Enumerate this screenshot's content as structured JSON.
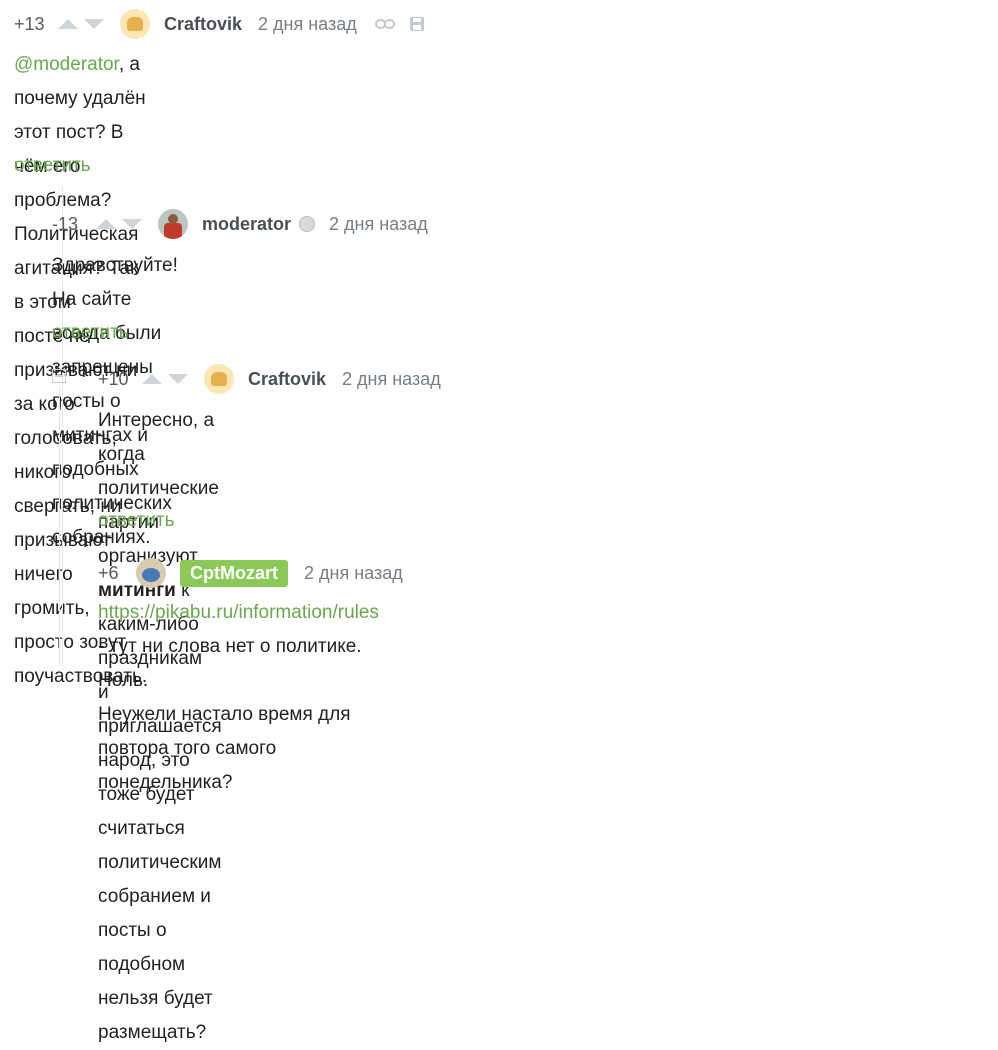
{
  "comments": [
    {
      "rating": "+13",
      "author": "Craftovik",
      "time": "2 дня назад",
      "mention": "@moderator",
      "text_line1": ", а почему удалён этот пост? В чём его проблема? Политическая агитация? Так в этом",
      "text_line2": "посте не призывают ни за кого голосовать, никого свергать, ни призывают ничего громить,",
      "text_line3": "просто зовут поучаствовать.",
      "reply": "ответить",
      "icons": [
        "link-icon",
        "save-icon"
      ]
    },
    {
      "rating": "-13",
      "author": "moderator",
      "time": "2 дня назад",
      "text_line1": "Здравствуйте! На сайте всегда были запрещены посты о митингах и подобных политических",
      "text_line2": "собраниях.",
      "reply": "ответить",
      "icons": [
        "moderator-badge-icon"
      ]
    },
    {
      "rating": "+10",
      "author": "Craftovik",
      "time": "2 дня назад",
      "text_line1_a": "Интересно, а когда политические партии организуют ",
      "text_line1_bold": "митинги",
      "text_line1_b": " к каким-либо праздникам",
      "text_line2": "и приглашается народ, это тоже будет считаться политическим собранием и посты о",
      "text_line3": "подобном нельзя будет размещать?",
      "reply": "ответить"
    },
    {
      "rating": "+6",
      "author": "CptMozart",
      "time": "2 дня назад",
      "link": "https://pikabu.ru/information/rules",
      "text_line1": " - тут ни слова нет о политике. Ноль.",
      "text_line2": "Неужели настало время для повтора того самого понедельника?"
    }
  ],
  "colors": {
    "accent": "#6aa84f",
    "badge": "#8ac858",
    "text": "#222222",
    "meta": "#787e84"
  }
}
